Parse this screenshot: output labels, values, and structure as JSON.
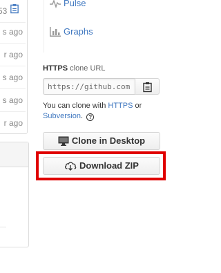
{
  "left_column": {
    "rows": [
      {
        "text": "53"
      },
      {
        "text": "s ago"
      },
      {
        "text": "r ago"
      },
      {
        "text": "s ago"
      },
      {
        "text": "s ago"
      },
      {
        "text": "r ago"
      }
    ]
  },
  "sidebar_nav": {
    "items": [
      {
        "label": "Pulse",
        "icon": "pulse-icon"
      },
      {
        "label": "Graphs",
        "icon": "graph-icon"
      }
    ]
  },
  "clone": {
    "protocol": "HTTPS",
    "label_suffix": "clone URL",
    "url_value": "https://github.com",
    "help_prefix": "You can clone with",
    "help_link_https": "HTTPS",
    "help_or": "or",
    "help_link_subversion": "Subversion",
    "help_period": ".",
    "help_icon_glyph": "?"
  },
  "buttons": {
    "clone_desktop": "Clone in Desktop",
    "download_zip": "Download ZIP"
  },
  "colors": {
    "link": "#4078c0",
    "highlight": "#e00000"
  }
}
